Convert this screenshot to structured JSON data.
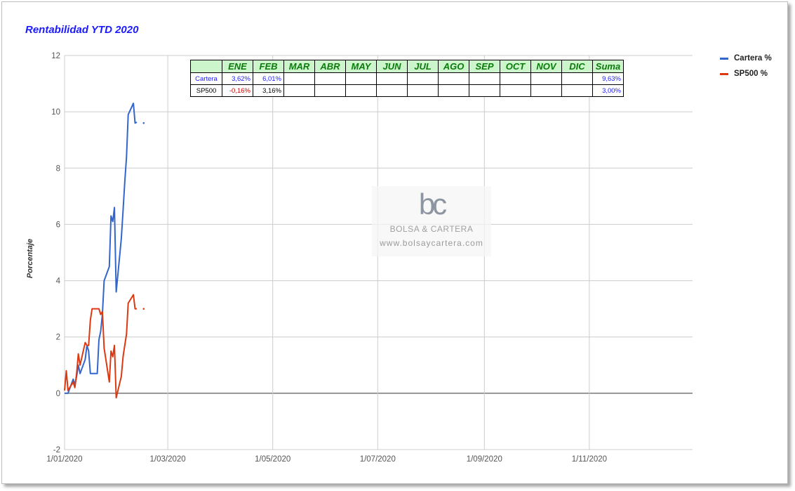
{
  "chart_data": {
    "type": "line",
    "title": "Rentabilidad YTD 2020",
    "ylabel": "Porcentaje",
    "xlabel": "",
    "ylim": [
      -2,
      12
    ],
    "yticks": [
      -2,
      0,
      2,
      4,
      6,
      8,
      10,
      12
    ],
    "xlim": [
      "2020-01-01",
      "2020-12-31"
    ],
    "xticks": [
      {
        "date": "2020-01-01",
        "label": "1/01/2020"
      },
      {
        "date": "2020-03-01",
        "label": "1/03/2020"
      },
      {
        "date": "2020-05-01",
        "label": "1/05/2020"
      },
      {
        "date": "2020-07-01",
        "label": "1/07/2020"
      },
      {
        "date": "2020-09-01",
        "label": "1/09/2020"
      },
      {
        "date": "2020-11-01",
        "label": "1/11/2020"
      }
    ],
    "grid": true,
    "legend_position": "right",
    "series": [
      {
        "name": "Cartera %",
        "color": "#3366cc",
        "x": [
          "2020-01-01",
          "2020-01-02",
          "2020-01-03",
          "2020-01-06",
          "2020-01-07",
          "2020-01-08",
          "2020-01-09",
          "2020-01-10",
          "2020-01-13",
          "2020-01-14",
          "2020-01-15",
          "2020-01-16",
          "2020-01-17",
          "2020-01-20",
          "2020-01-21",
          "2020-01-22",
          "2020-01-23",
          "2020-01-24",
          "2020-01-27",
          "2020-01-28",
          "2020-01-29",
          "2020-01-30",
          "2020-01-31",
          "2020-02-03",
          "2020-02-04",
          "2020-02-05",
          "2020-02-06",
          "2020-02-07",
          "2020-02-10",
          "2020-02-11",
          "2020-02-12",
          "2020-02-13",
          "2020-02-14",
          "2020-02-18",
          "2020-02-19",
          "2020-02-20",
          "2020-02-21"
        ],
        "values": [
          0.0,
          0.0,
          0.0,
          0.5,
          0.3,
          0.6,
          1.0,
          0.7,
          1.2,
          1.7,
          1.5,
          0.7,
          0.7,
          0.7,
          1.9,
          2.2,
          2.8,
          4.0,
          4.5,
          6.3,
          6.1,
          6.6,
          3.6,
          5.5,
          6.5,
          7.5,
          8.4,
          9.9,
          10.3,
          9.6,
          9.63,
          null,
          null,
          null,
          null,
          null,
          null
        ],
        "isolated_points": [
          {
            "x": "2020-02-16",
            "y": 9.6
          }
        ]
      },
      {
        "name": "SP500 %",
        "color": "#dc3912",
        "x": [
          "2020-01-01",
          "2020-01-02",
          "2020-01-03",
          "2020-01-06",
          "2020-01-07",
          "2020-01-08",
          "2020-01-09",
          "2020-01-10",
          "2020-01-13",
          "2020-01-14",
          "2020-01-15",
          "2020-01-16",
          "2020-01-17",
          "2020-01-20",
          "2020-01-21",
          "2020-01-22",
          "2020-01-23",
          "2020-01-24",
          "2020-01-27",
          "2020-01-28",
          "2020-01-29",
          "2020-01-30",
          "2020-01-31",
          "2020-02-03",
          "2020-02-04",
          "2020-02-05",
          "2020-02-06",
          "2020-02-07",
          "2020-02-10",
          "2020-02-11",
          "2020-02-12",
          "2020-02-13",
          "2020-02-14",
          "2020-02-18",
          "2020-02-19",
          "2020-02-20",
          "2020-02-21"
        ],
        "values": [
          0.1,
          0.8,
          0.1,
          0.4,
          0.2,
          0.7,
          1.4,
          1.0,
          1.8,
          1.7,
          1.7,
          2.6,
          3.0,
          3.0,
          3.0,
          2.8,
          2.9,
          1.6,
          0.4,
          1.5,
          1.3,
          1.7,
          -0.16,
          0.6,
          1.3,
          1.7,
          2.1,
          3.2,
          3.5,
          3.0,
          3.0,
          null,
          null,
          null,
          null,
          null,
          null
        ],
        "isolated_points": [
          {
            "x": "2020-02-16",
            "y": 3.0
          }
        ]
      }
    ]
  },
  "summary_table": {
    "headers": [
      "",
      "ENE",
      "FEB",
      "MAR",
      "ABR",
      "MAY",
      "JUN",
      "JUL",
      "AGO",
      "SEP",
      "OCT",
      "NOV",
      "DIC",
      "Suma"
    ],
    "rows": [
      {
        "label": "Cartera",
        "label_color": "#1a1aff",
        "cells": [
          "3,62%",
          "6,01%",
          "",
          "",
          "",
          "",
          "",
          "",
          "",
          "",
          "",
          "",
          "9,63%"
        ],
        "colors": [
          "#1a1aff",
          "#1a1aff",
          "",
          "",
          "",
          "",
          "",
          "",
          "",
          "",
          "",
          "",
          "#1a1aff"
        ]
      },
      {
        "label": "SP500",
        "label_color": "#000000",
        "cells": [
          "-0,16%",
          "3,16%",
          "",
          "",
          "",
          "",
          "",
          "",
          "",
          "",
          "",
          "",
          "3,00%"
        ],
        "colors": [
          "#cc0000",
          "#000000",
          "",
          "",
          "",
          "",
          "",
          "",
          "",
          "",
          "",
          "",
          "#1a1aff"
        ]
      }
    ]
  },
  "watermark": {
    "logo": "bc",
    "name": "BOLSA & CARTERA",
    "url": "www.bolsaycartera.com"
  }
}
